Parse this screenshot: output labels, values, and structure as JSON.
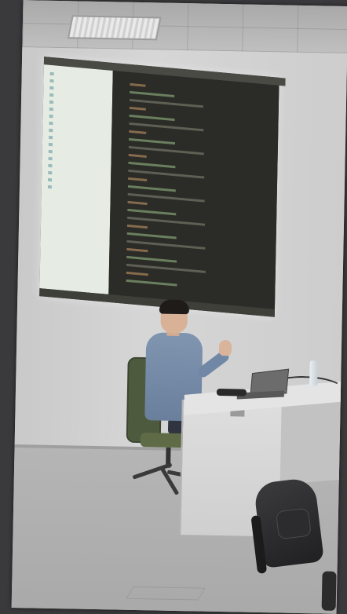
{
  "photo": {
    "projection": {
      "sidebar_items": [
        "",
        "",
        "",
        "",
        "",
        "",
        "",
        "",
        "",
        "",
        "",
        "",
        "",
        "",
        "",
        "",
        ""
      ],
      "code_lines": [
        {
          "kw": "",
          "text": ""
        },
        {
          "kw": "",
          "text": ""
        },
        {
          "kw": "",
          "text": ""
        },
        {
          "kw": "",
          "text": ""
        },
        {
          "kw": "",
          "text": ""
        },
        {
          "kw": "",
          "text": ""
        },
        {
          "kw": "",
          "text": ""
        },
        {
          "kw": "",
          "text": ""
        },
        {
          "kw": "",
          "text": ""
        },
        {
          "kw": "",
          "text": ""
        },
        {
          "kw": "",
          "text": ""
        },
        {
          "kw": "",
          "text": ""
        },
        {
          "kw": "",
          "text": ""
        },
        {
          "kw": "",
          "text": ""
        },
        {
          "kw": "",
          "text": ""
        },
        {
          "kw": "",
          "text": ""
        },
        {
          "kw": "",
          "text": ""
        },
        {
          "kw": "",
          "text": ""
        },
        {
          "kw": "",
          "text": ""
        },
        {
          "kw": "",
          "text": ""
        },
        {
          "kw": "",
          "text": ""
        },
        {
          "kw": "",
          "text": ""
        },
        {
          "kw": "",
          "text": ""
        },
        {
          "kw": "",
          "text": ""
        },
        {
          "kw": "",
          "text": ""
        },
        {
          "kw": "",
          "text": ""
        }
      ]
    },
    "colors": {
      "editor_bg": "#2b2b28",
      "sidebar_bg": "#e6ece4",
      "shirt": "#7f95b0",
      "chair": "#5e6b46"
    }
  }
}
